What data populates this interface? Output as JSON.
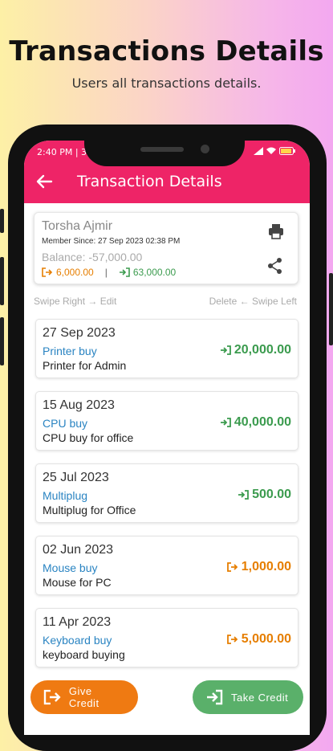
{
  "promo": {
    "title": "Transactions Details",
    "subtitle": "Users all transactions details."
  },
  "status_bar": {
    "time": "2:40 PM | 36"
  },
  "header": {
    "title": "Transaction Details"
  },
  "user": {
    "name": "Torsha Ajmir",
    "member_since": "Member Since: 27 Sep 2023 02:38 PM",
    "balance": "Balance: -57,000.00",
    "give_total": "6,000.00",
    "take_total": "63,000.00"
  },
  "hints": {
    "left": "Swipe Right → Edit",
    "right": "Delete ← Swipe Left"
  },
  "transactions": [
    {
      "date": "27 Sep 2023",
      "title": "Printer buy",
      "desc": "Printer for Admin",
      "amount": "20,000.00",
      "type": "take"
    },
    {
      "date": "15 Aug 2023",
      "title": "CPU buy",
      "desc": "CPU buy for office",
      "amount": "40,000.00",
      "type": "take"
    },
    {
      "date": "25 Jul 2023",
      "title": "Multiplug",
      "desc": "Multiplug for Office",
      "amount": "500.00",
      "type": "take"
    },
    {
      "date": "02 Jun 2023",
      "title": "Mouse buy",
      "desc": "Mouse for PC",
      "amount": "1,000.00",
      "type": "give"
    },
    {
      "date": "11 Apr 2023",
      "title": "Keyboard buy",
      "desc": "keyboard buying",
      "amount": "5,000.00",
      "type": "give"
    }
  ],
  "actions": {
    "give_label": "Give Credit",
    "take_label": "Take Credit"
  },
  "colors": {
    "appbar": "#ee2467",
    "give": "#e67e00",
    "take": "#3b9b4e",
    "link": "#2a84c2"
  }
}
